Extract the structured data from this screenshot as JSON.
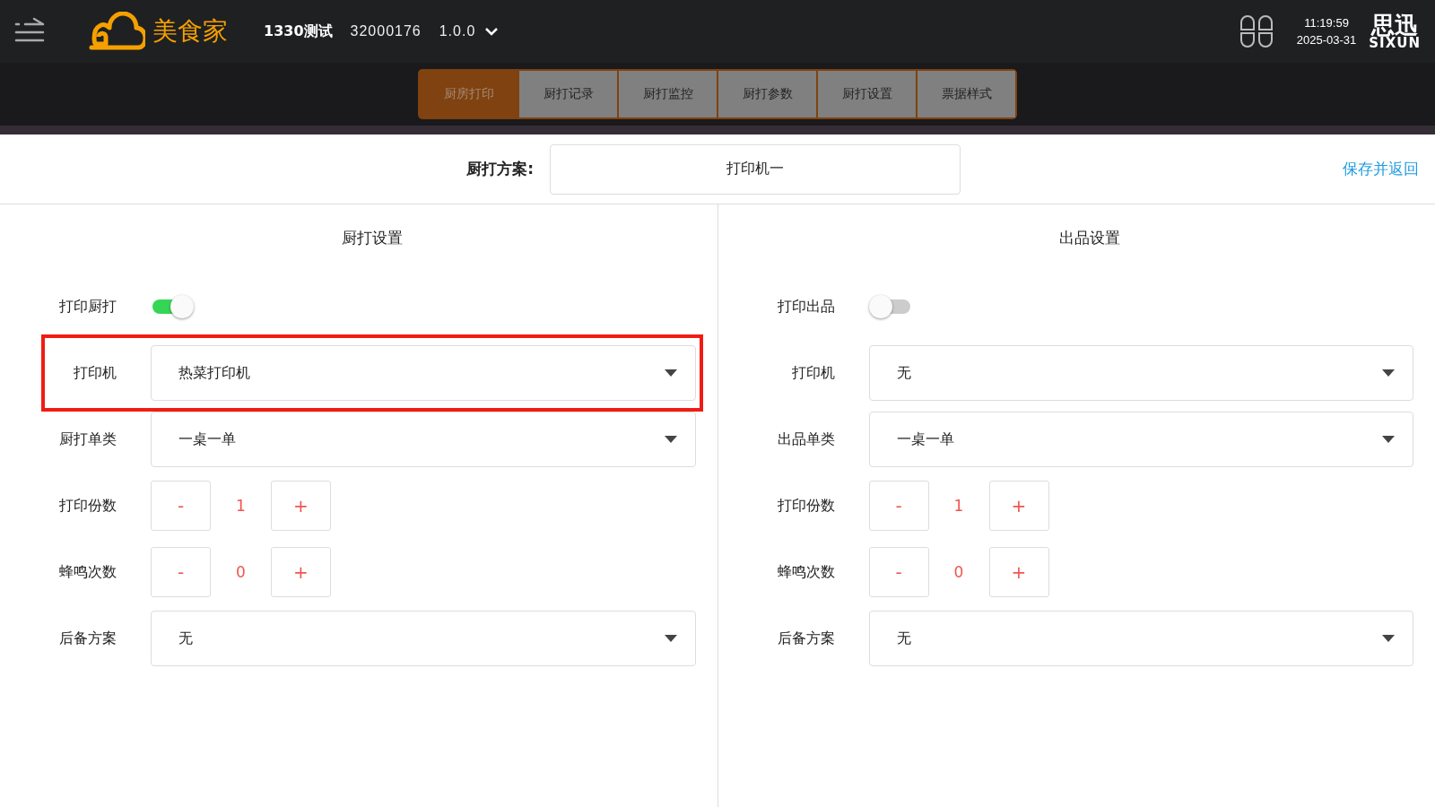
{
  "header": {
    "brand": "美食家",
    "store": "1330测试",
    "store_id": "32000176",
    "version": "1.0.0",
    "time": "11:19:59",
    "date": "2025-03-31",
    "vendor_name": "思迅",
    "vendor_latin": "SIXUN"
  },
  "tabs": [
    {
      "label": "厨房打印",
      "selected": true
    },
    {
      "label": "厨打记录",
      "selected": false
    },
    {
      "label": "厨打监控",
      "selected": false
    },
    {
      "label": "厨打参数",
      "selected": false
    },
    {
      "label": "厨打设置",
      "selected": false
    },
    {
      "label": "票据样式",
      "selected": false
    }
  ],
  "plan": {
    "label": "厨打方案:",
    "value": "打印机一",
    "action": "保存并返回"
  },
  "panels": [
    {
      "title": "厨打设置",
      "rows": [
        {
          "kind": "toggle",
          "label": "打印厨打",
          "on": true,
          "highlighted": false
        },
        {
          "kind": "select",
          "label": "打印机",
          "value": "热菜打印机",
          "highlighted": true
        },
        {
          "kind": "select",
          "label": "厨打单类",
          "value": "一桌一单",
          "highlighted": false
        },
        {
          "kind": "stepper",
          "label": "打印份数",
          "minus": "-",
          "value": "1",
          "plus": "+",
          "highlighted": false
        },
        {
          "kind": "stepper",
          "label": "蜂鸣次数",
          "minus": "-",
          "value": "0",
          "plus": "+",
          "highlighted": false
        },
        {
          "kind": "select",
          "label": "后备方案",
          "value": "无",
          "highlighted": false
        }
      ]
    },
    {
      "title": "出品设置",
      "rows": [
        {
          "kind": "toggle",
          "label": "打印出品",
          "on": false,
          "highlighted": false
        },
        {
          "kind": "select",
          "label": "打印机",
          "value": "无",
          "highlighted": false
        },
        {
          "kind": "select",
          "label": "出品单类",
          "value": "一桌一单",
          "highlighted": false
        },
        {
          "kind": "stepper",
          "label": "打印份数",
          "minus": "-",
          "value": "1",
          "plus": "+",
          "highlighted": false
        },
        {
          "kind": "stepper",
          "label": "蜂鸣次数",
          "minus": "-",
          "value": "0",
          "plus": "+",
          "highlighted": false
        },
        {
          "kind": "select",
          "label": "后备方案",
          "value": "无",
          "highlighted": false
        }
      ]
    }
  ]
}
